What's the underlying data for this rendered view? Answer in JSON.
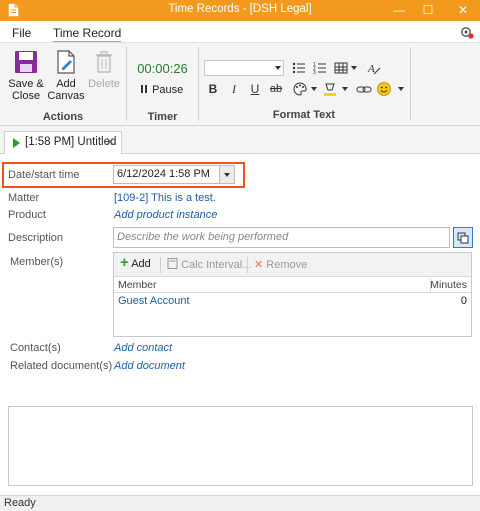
{
  "window": {
    "title": "Time Records - [DSH Legal]",
    "controls": {
      "minimize": "—",
      "maximize": "☐",
      "close": "✕"
    }
  },
  "menu": {
    "tabs": [
      {
        "label": "File",
        "active": false
      },
      {
        "label": "Time Record",
        "active": true
      }
    ]
  },
  "ribbon": {
    "actions": {
      "save_close": "Save & Close",
      "add_canvas": "Add Canvas",
      "delete": "Delete",
      "group_label": "Actions"
    },
    "timer": {
      "value": "00:00:26",
      "pause_label": "Pause",
      "group_label": "Timer"
    },
    "format_text": {
      "group_label": "Format Text"
    }
  },
  "doc_tab": {
    "label": "[1:58 PM] Untitled",
    "close": "✕"
  },
  "form": {
    "date_start": {
      "label": "Date/start time",
      "value": "6/12/2024 1:58 PM"
    },
    "matter": {
      "label": "Matter",
      "value": "[109-2] This is a test."
    },
    "product": {
      "label": "Product",
      "value": "Add product instance"
    },
    "description": {
      "label": "Description",
      "placeholder": "Describe the work being performed"
    },
    "members": {
      "label": "Member(s)",
      "toolbar": {
        "add": "Add",
        "calc_interval": "Calc Interval...",
        "remove": "Remove"
      },
      "columns": [
        "Member",
        "Minutes"
      ],
      "rows": [
        {
          "member": "Guest Account",
          "minutes": "0"
        }
      ]
    },
    "contacts": {
      "label": "Contact(s)",
      "value": "Add contact"
    },
    "related_documents": {
      "label": "Related document(s)",
      "value": "Add document"
    }
  },
  "status": {
    "text": "Ready"
  },
  "colors": {
    "titlebar": "#f39a1e",
    "highlight": "#e8561e",
    "link": "#1e5fa8",
    "timer": "#2a7d2e"
  }
}
